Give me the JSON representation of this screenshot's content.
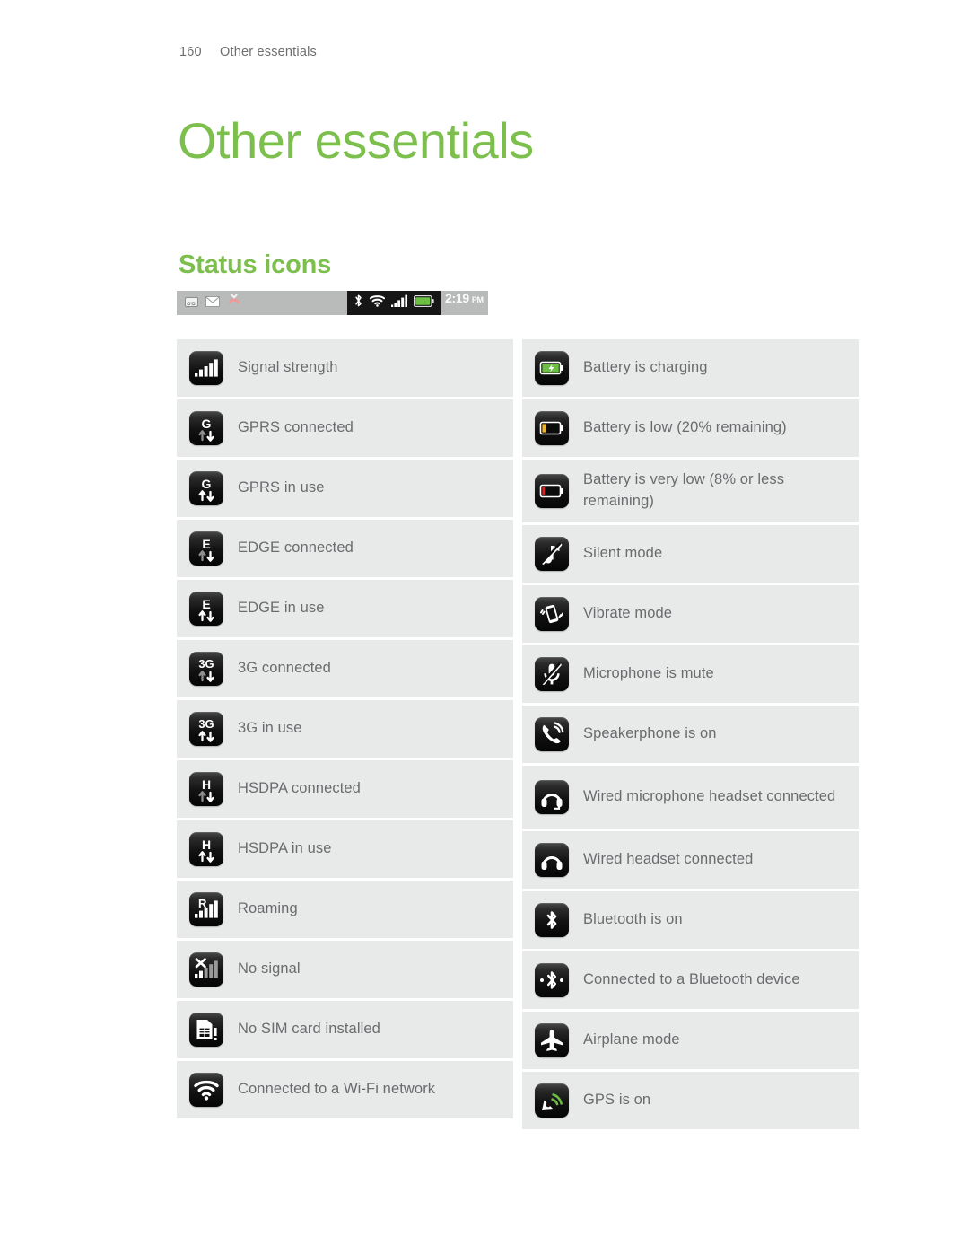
{
  "colors": {
    "accent_green": "#7cbf4c",
    "row_bg": "#e8eaea",
    "text_gray": "#6a6b6d",
    "battery_full": "#6dbe45",
    "battery_low": "#f0b323",
    "battery_very_low": "#e02020",
    "statusbar_gray": "#b9bbbb",
    "statusbar_dark": "#161616"
  },
  "running_header": {
    "page_number": "160",
    "section": "Other essentials"
  },
  "chapter_title": "Other essentials",
  "section_title": "Status icons",
  "status_bar": {
    "notification_icons": [
      "voicemail-icon",
      "mail-icon",
      "missed-call-icon"
    ],
    "system_icons": [
      "bluetooth-icon",
      "wifi-icon",
      "signal-icon",
      "battery-icon"
    ],
    "time": "2:19",
    "meridiem": "PM"
  },
  "table": {
    "left_column": [
      {
        "icon": "signal-strength-icon",
        "label": "Signal strength",
        "lines": 1
      },
      {
        "icon": "gprs-connected-icon",
        "label": "GPRS connected",
        "lines": 1
      },
      {
        "icon": "gprs-in-use-icon",
        "label": "GPRS in use",
        "lines": 1
      },
      {
        "icon": "edge-connected-icon",
        "label": "EDGE connected",
        "lines": 1
      },
      {
        "icon": "edge-in-use-icon",
        "label": "EDGE in use",
        "lines": 1
      },
      {
        "icon": "3g-connected-icon",
        "label": "3G connected",
        "lines": 1
      },
      {
        "icon": "3g-in-use-icon",
        "label": "3G in use",
        "lines": 1
      },
      {
        "icon": "hsdpa-connected-icon",
        "label": "HSDPA connected",
        "lines": 1
      },
      {
        "icon": "hsdpa-in-use-icon",
        "label": "HSDPA in use",
        "lines": 1
      },
      {
        "icon": "roaming-icon",
        "label": "Roaming",
        "lines": 1
      },
      {
        "icon": "no-signal-icon",
        "label": "No signal",
        "lines": 1
      },
      {
        "icon": "no-sim-card-icon",
        "label": "No SIM card installed",
        "lines": 1
      },
      {
        "icon": "wifi-connected-icon",
        "label": "Connected to a Wi-Fi network",
        "lines": 1
      }
    ],
    "right_column": [
      {
        "icon": "battery-charging-icon",
        "label": "Battery is charging",
        "lines": 1
      },
      {
        "icon": "battery-low-icon",
        "label": "Battery is low (20% remaining)",
        "lines": 1
      },
      {
        "icon": "battery-very-low-icon",
        "label": "Battery is very low (8% or less remaining)",
        "lines": 2
      },
      {
        "icon": "silent-mode-icon",
        "label": "Silent mode",
        "lines": 1
      },
      {
        "icon": "vibrate-mode-icon",
        "label": "Vibrate mode",
        "lines": 1
      },
      {
        "icon": "microphone-mute-icon",
        "label": "Microphone is mute",
        "lines": 1
      },
      {
        "icon": "speakerphone-icon",
        "label": "Speakerphone is on",
        "lines": 1
      },
      {
        "icon": "wired-mic-headset-icon",
        "label": "Wired microphone headset connected",
        "lines": 2
      },
      {
        "icon": "wired-headset-icon",
        "label": "Wired headset connected",
        "lines": 1
      },
      {
        "icon": "bluetooth-on-icon",
        "label": "Bluetooth is on",
        "lines": 1
      },
      {
        "icon": "bluetooth-connected-icon",
        "label": "Connected to a Bluetooth device",
        "lines": 1
      },
      {
        "icon": "airplane-mode-icon",
        "label": "Airplane mode",
        "lines": 1
      },
      {
        "icon": "gps-on-icon",
        "label": "GPS is on",
        "lines": 1
      }
    ]
  }
}
